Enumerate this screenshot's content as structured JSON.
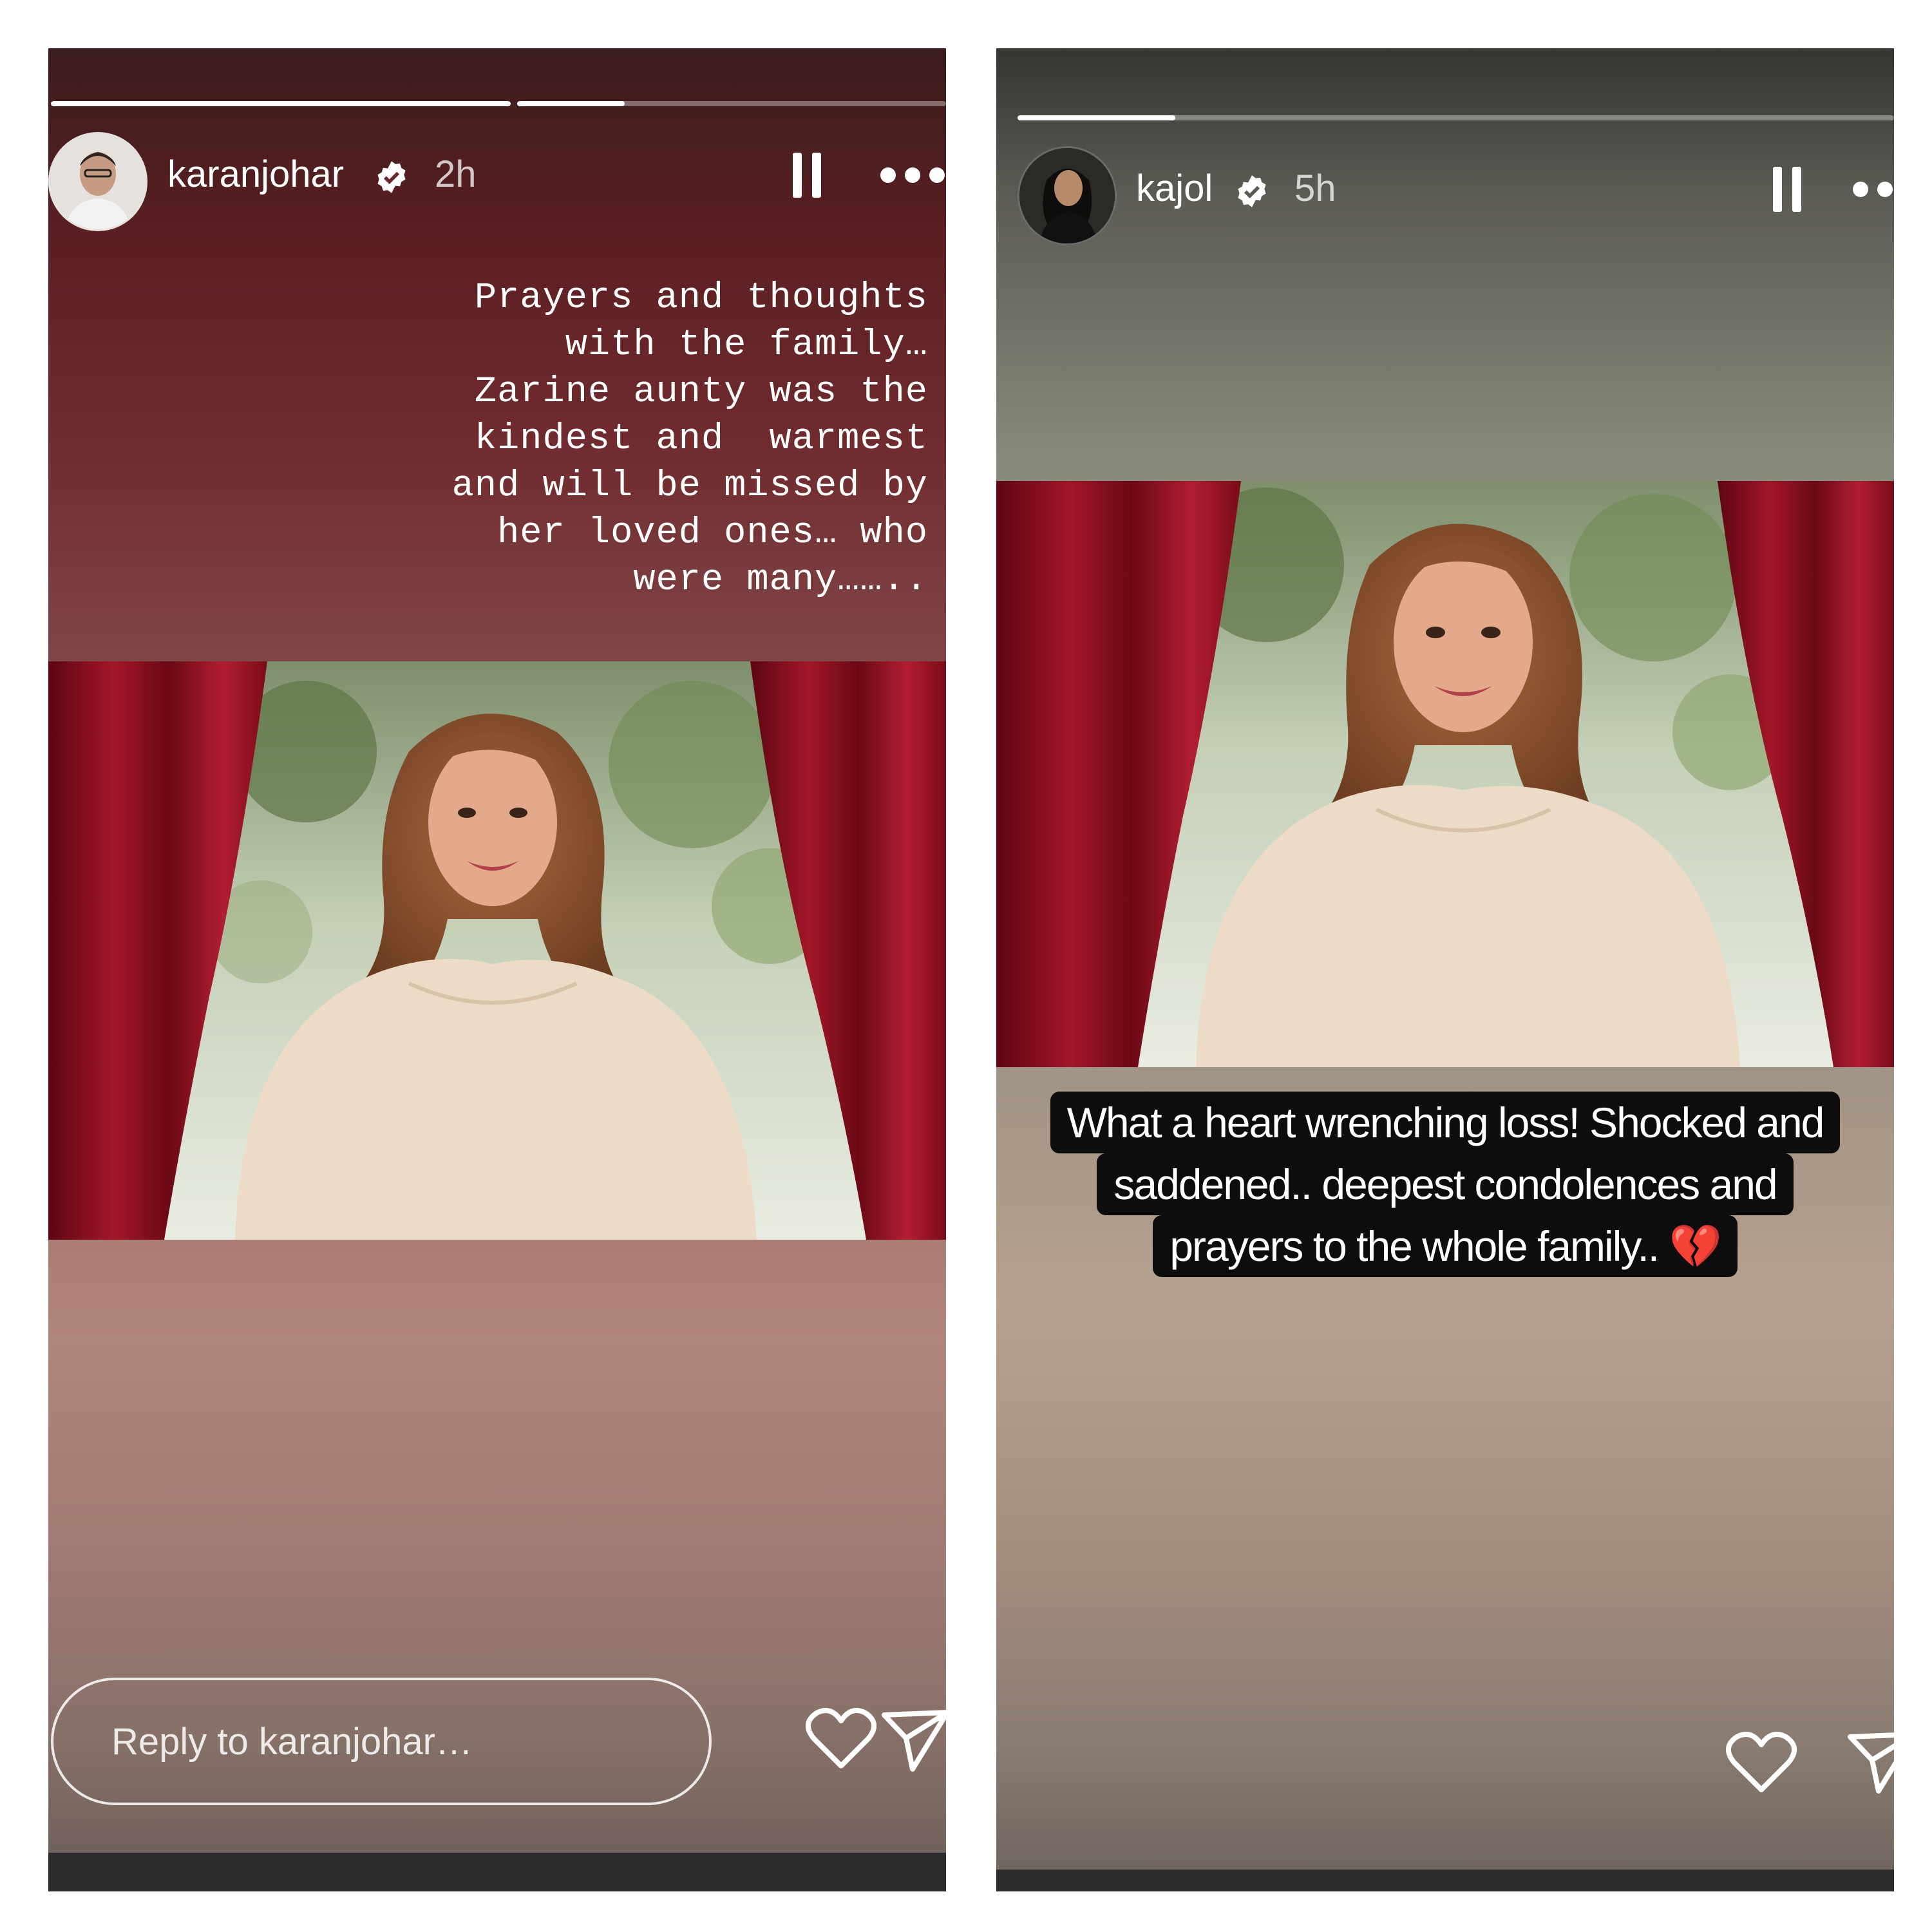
{
  "stories": [
    {
      "username": "karanjohar",
      "verified": true,
      "time": "2h",
      "progress": [
        1.0,
        0.25
      ],
      "caption": "Prayers and thoughts\nwith the family…\nZarine aunty was the\nkindest and  warmest\nand will be missed by\nher loved ones… who\nwere many……..",
      "reply_placeholder": "Reply to karanjohar…",
      "icons": [
        "pause-icon",
        "more-icon",
        "heart-icon",
        "send-icon",
        "verified-badge-icon"
      ]
    },
    {
      "username": "kajol",
      "verified": true,
      "time": "5h",
      "progress": [
        0.18
      ],
      "sticker_lines": [
        "What a heart wrenching loss! Shocked and",
        "saddened.. deepest condolences and",
        "prayers to the whole family.. 💔"
      ],
      "icons": [
        "pause-icon",
        "more-icon",
        "heart-icon",
        "send-icon",
        "verified-badge-icon"
      ]
    }
  ],
  "colors": {
    "curtain": "#8c0f1e",
    "sticker_bg": "#0d0d0d",
    "text": "#ffffff"
  }
}
